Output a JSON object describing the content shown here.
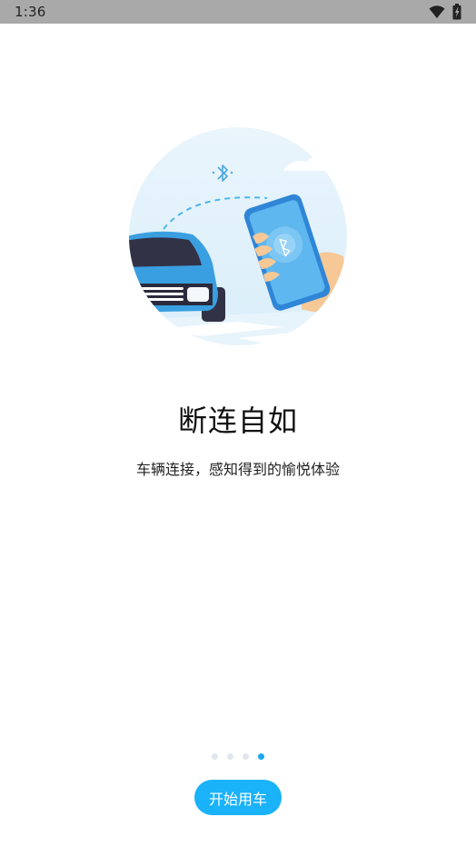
{
  "status_bar": {
    "time": "1:36",
    "icons": [
      "wifi-icon",
      "battery-icon"
    ]
  },
  "onboarding": {
    "title": "断连自如",
    "subtitle": "车辆连接，感知得到的愉悦体验",
    "page_indicator": {
      "total": 4,
      "current": 4
    },
    "start_button_label": "开始用车"
  },
  "illustration": {
    "subject": "car-and-phone-bluetooth",
    "icons": [
      "bluetooth-icon"
    ]
  },
  "colors": {
    "accent": "#1ab2f8",
    "status_bar": "#a9a9a9",
    "dot_inactive": "#e3e6ee",
    "dot_active": "#1aa7f0"
  }
}
